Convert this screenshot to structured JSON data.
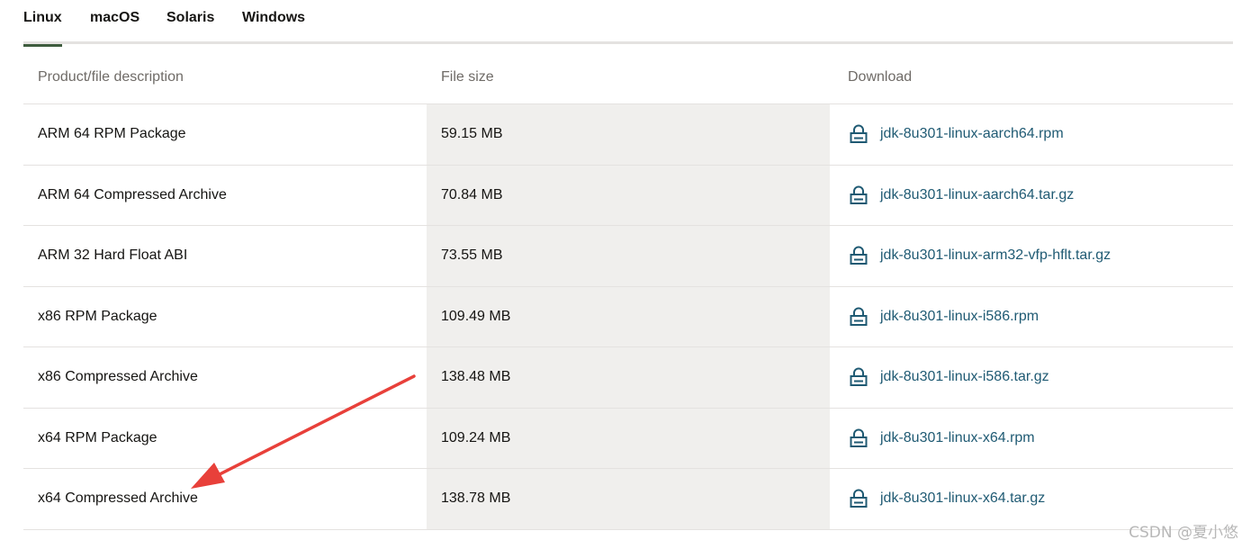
{
  "tabs": [
    {
      "label": "Linux",
      "active": true
    },
    {
      "label": "macOS",
      "active": false
    },
    {
      "label": "Solaris",
      "active": false
    },
    {
      "label": "Windows",
      "active": false
    }
  ],
  "table": {
    "headers": [
      "Product/file description",
      "File size",
      "Download"
    ],
    "rows": [
      {
        "description": "ARM 64 RPM Package",
        "size": "59.15 MB",
        "file": "jdk-8u301-linux-aarch64.rpm"
      },
      {
        "description": "ARM 64 Compressed Archive",
        "size": "70.84 MB",
        "file": "jdk-8u301-linux-aarch64.tar.gz"
      },
      {
        "description": "ARM 32 Hard Float ABI",
        "size": "73.55 MB",
        "file": "jdk-8u301-linux-arm32-vfp-hflt.tar.gz"
      },
      {
        "description": "x86 RPM Package",
        "size": "109.49 MB",
        "file": "jdk-8u301-linux-i586.rpm"
      },
      {
        "description": "x86 Compressed Archive",
        "size": "138.48 MB",
        "file": "jdk-8u301-linux-i586.tar.gz"
      },
      {
        "description": "x64 RPM Package",
        "size": "109.24 MB",
        "file": "jdk-8u301-linux-x64.rpm"
      },
      {
        "description": "x64 Compressed Archive",
        "size": "138.78 MB",
        "file": "jdk-8u301-linux-x64.tar.gz"
      }
    ]
  },
  "icons": {
    "download": "lock-icon"
  },
  "colors": {
    "link": "#1f5a73",
    "active_tab_underline": "#3f5d3f",
    "annotation_arrow": "#e8403a",
    "size_column_bg": "#f0efed"
  },
  "watermark": "CSDN @夏小悠"
}
